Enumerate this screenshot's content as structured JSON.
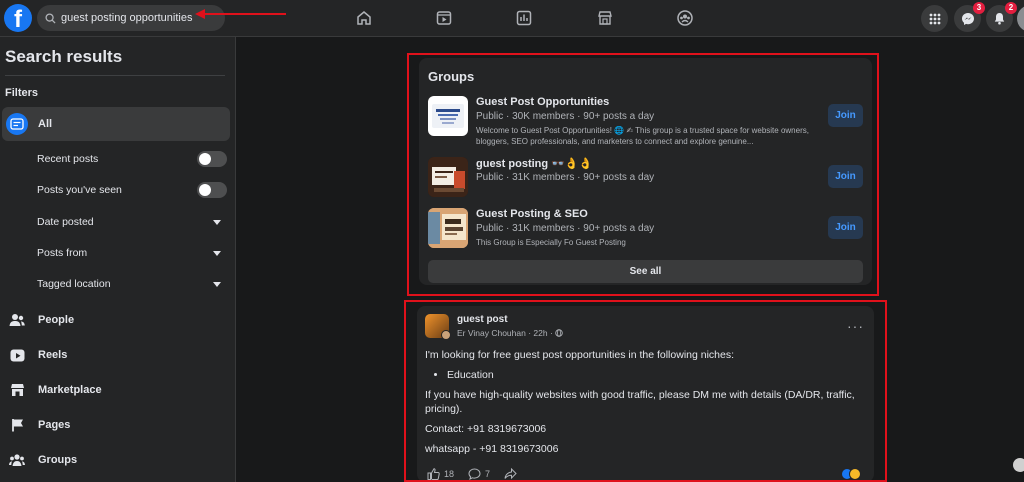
{
  "topbar": {
    "logo": "f",
    "search_value": "guest posting opportunities",
    "nav_icons": [
      "home-icon",
      "video-icon",
      "chart-icon",
      "marketplace-icon",
      "groups-icon"
    ],
    "messenger_badge": "3",
    "notifications_badge": "2"
  },
  "sidebar": {
    "title": "Search results",
    "filters_label": "Filters",
    "items": [
      {
        "label": "All",
        "icon": "all-icon"
      },
      {
        "label": "People",
        "icon": "people-icon"
      },
      {
        "label": "Reels",
        "icon": "reels-icon"
      },
      {
        "label": "Marketplace",
        "icon": "marketplace-icon"
      },
      {
        "label": "Pages",
        "icon": "pages-icon"
      },
      {
        "label": "Groups",
        "icon": "groups-icon"
      }
    ],
    "sub_filters": [
      {
        "label": "Recent posts",
        "control": "toggle"
      },
      {
        "label": "Posts you've seen",
        "control": "toggle"
      },
      {
        "label": "Date posted",
        "control": "dropdown"
      },
      {
        "label": "Posts from",
        "control": "dropdown"
      },
      {
        "label": "Tagged location",
        "control": "dropdown"
      }
    ]
  },
  "groups": {
    "title": "Groups",
    "join_label": "Join",
    "see_all_label": "See all",
    "items": [
      {
        "name": "Guest Post Opportunities",
        "meta": "Public · 30K members · 90+ posts a day",
        "description": "Welcome to Guest Post Opportunities! 🌐 ✍ This group is a trusted space for website owners, bloggers, SEO professionals, and marketers to connect and explore genuine..."
      },
      {
        "name": "guest posting 👓👌👌",
        "meta": "Public · 31K members · 90+ posts a day",
        "description": ""
      },
      {
        "name": "Guest Posting & SEO",
        "meta": "Public · 31K members · 90+ posts a day",
        "description": "This Group is Especially Fo Guest Posting"
      }
    ]
  },
  "post": {
    "group": "guest post",
    "author": "Er Vinay Chouhan",
    "time": "22h",
    "more": "···",
    "line1": "I'm looking for free guest post opportunities in the following niches:",
    "bullet": "Education",
    "line2": "If you have high-quality websites with good traffic, please DM me with details (DA/DR, traffic, pricing).",
    "contact": "Contact: +91 8319673006",
    "whatsapp": "whatsapp - +91 8319673006",
    "likes": "18",
    "comments": "7"
  },
  "colors": {
    "accent": "#1877f2",
    "highlight_box": "#e0111b",
    "badge": "#e41e3f"
  }
}
